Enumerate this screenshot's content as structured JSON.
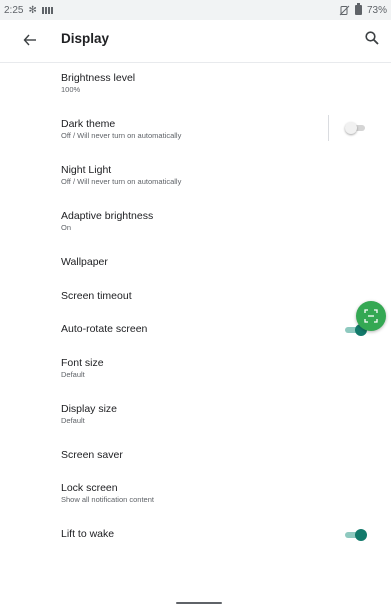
{
  "status": {
    "time": "2:25",
    "battery_text": "73%"
  },
  "header": {
    "title": "Display",
    "back_icon": "arrow-back-icon",
    "search_icon": "search-icon"
  },
  "items": [
    {
      "label": "Brightness level",
      "sub": "100%"
    },
    {
      "label": "Dark theme",
      "sub": "Off / Will never turn on automatically",
      "toggle": false
    },
    {
      "label": "Night Light",
      "sub": "Off / Will never turn on automatically"
    },
    {
      "label": "Adaptive brightness",
      "sub": "On"
    },
    {
      "label": "Wallpaper"
    },
    {
      "label": "Screen timeout"
    },
    {
      "label": "Auto-rotate screen",
      "toggle": true
    },
    {
      "label": "Font size",
      "sub": "Default"
    },
    {
      "label": "Display size",
      "sub": "Default"
    },
    {
      "label": "Screen saver"
    },
    {
      "label": "Lock screen",
      "sub": "Show all notification content"
    },
    {
      "label": "Lift to wake",
      "toggle": true
    }
  ],
  "colors": {
    "accent": "#137a6b",
    "accent_track": "#8ec9bf",
    "fab": "#34a853"
  }
}
